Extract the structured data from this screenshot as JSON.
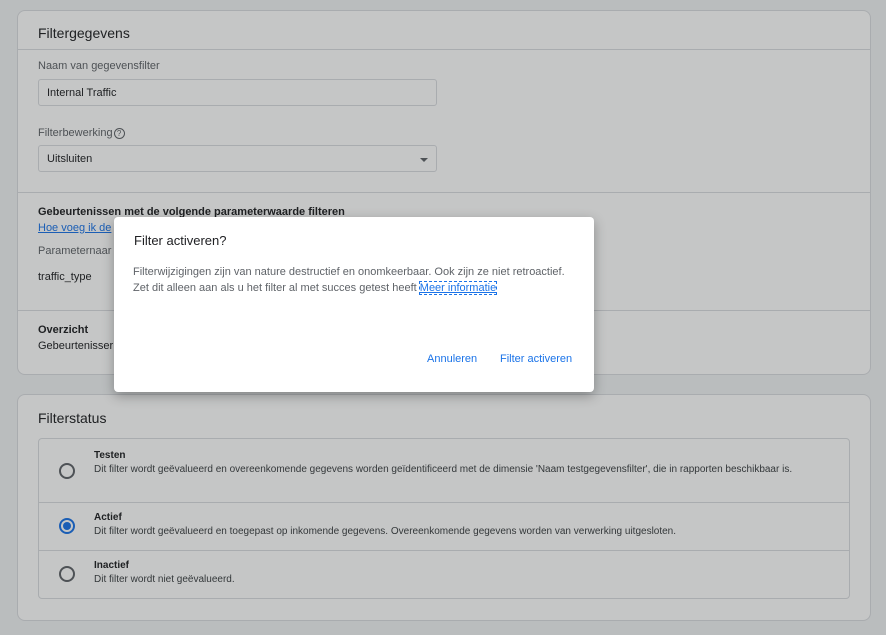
{
  "filter_card": {
    "title": "Filtergegevens",
    "name_label": "Naam van gegevensfilter",
    "name_value": "Internal Traffic",
    "operation_label": "Filterbewerking",
    "operation_value": "Uitsluiten",
    "events_heading": "Gebeurtenissen met de volgende parameterwaarde filteren",
    "events_link": "Hoe voeg ik de",
    "param_name_label": "Parameternaar",
    "param_value": "traffic_type",
    "overview_heading": "Overzicht",
    "overview_text": "Gebeurtenisser"
  },
  "status_card": {
    "title": "Filterstatus",
    "options": [
      {
        "title": "Testen",
        "description": "Dit filter wordt geëvalueerd en overeenkomende gegevens worden geïdentificeerd met de dimensie 'Naam testgegevensfilter', die in rapporten beschikbaar is.",
        "checked": false
      },
      {
        "title": "Actief",
        "description": "Dit filter wordt geëvalueerd en toegepast op inkomende gegevens. Overeenkomende gegevens worden van verwerking uitgesloten.",
        "checked": true
      },
      {
        "title": "Inactief",
        "description": "Dit filter wordt niet geëvalueerd.",
        "checked": false
      }
    ]
  },
  "dialog": {
    "title": "Filter activeren?",
    "body": "Filterwijzigingen zijn van nature destructief en onomkeerbaar. Ook zijn ze niet retroactief. Zet dit alleen aan als u het filter al met succes getest heeft",
    "link": "Meer informatie",
    "cancel_label": "Annuleren",
    "confirm_label": "Filter activeren"
  },
  "colors": {
    "accent": "#1a73e8",
    "text": "#202124",
    "border": "#dadce0"
  },
  "icons": {
    "help": "help-circle-icon",
    "dropdown": "chevron-down-icon"
  }
}
